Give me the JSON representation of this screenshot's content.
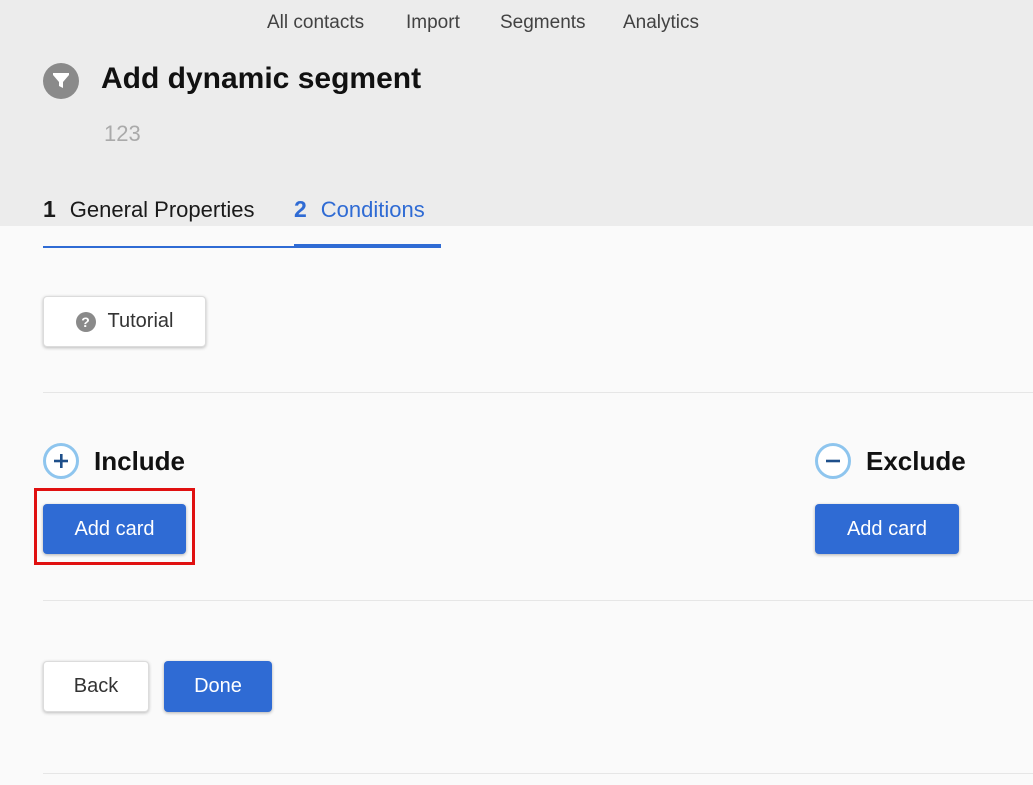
{
  "topnav": [
    "All contacts",
    "Import",
    "Segments",
    "Analytics"
  ],
  "header": {
    "title": "Add dynamic segment",
    "subtitle": "123",
    "icon": "funnel-icon"
  },
  "tabs": [
    {
      "number": "1",
      "label": "General Properties"
    },
    {
      "number": "2",
      "label": "Conditions",
      "active": true
    }
  ],
  "tutorial": {
    "label": "Tutorial",
    "icon": "question-circle-icon"
  },
  "include": {
    "title": "Include",
    "add_label": "Add card",
    "icon": "plus-circle-icon"
  },
  "exclude": {
    "title": "Exclude",
    "add_label": "Add card",
    "icon": "minus-circle-icon"
  },
  "footer": {
    "back_label": "Back",
    "done_label": "Done"
  },
  "colors": {
    "accent": "#2f6bd4",
    "icon_ring": "#8ec5ee",
    "highlight": "#e01010",
    "header_bg": "#ececec"
  }
}
